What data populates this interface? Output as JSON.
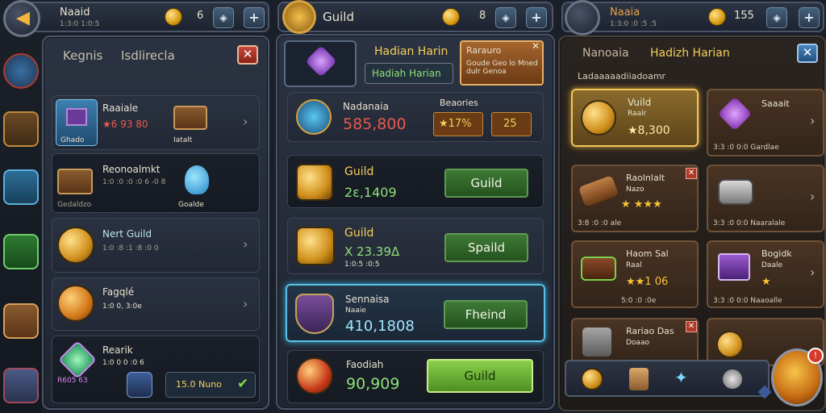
{
  "left": {
    "topbar": {
      "title": "Naaid",
      "subtitle": "1:3:0 1:0:5",
      "coins": "6"
    },
    "panel": {
      "tab_a": "Kegnis",
      "tab_b": "Isdlirecla",
      "rows": [
        {
          "title": "Raaiale",
          "value": "★6 93 80",
          "caption": "Ghado",
          "item_caption": "Iatalt"
        },
        {
          "title": "Reonoalmkt",
          "subtitle": "1:0 :0 :0 :0 6 -0 8",
          "caption": "Gedaldzo",
          "item_caption": "Goalde"
        },
        {
          "title": "Nert Guild",
          "value": "1:0 :8 :1 :8 :0 0"
        },
        {
          "title": "Fagqlé",
          "value": "1:0 0, 3:0e"
        },
        {
          "title": "Rearik",
          "value": "1:0 0 0 :0 6",
          "price": "R605 63"
        }
      ],
      "footer_value": "15.0 Nuno"
    }
  },
  "middle": {
    "topbar": {
      "title": "Guild",
      "coins": "8"
    },
    "header": {
      "title": "Hadian Harin",
      "tab": "Hadiah Harian",
      "banner_title": "Rarauro",
      "banner_text": "Goude Geo lo Mned dulr Genoa"
    },
    "rows": [
      {
        "title": "Nadanaia",
        "value": "585,800",
        "label": "Beaories",
        "badge": "★17%",
        "count": "25"
      },
      {
        "title": "Guild",
        "value": "2ε,1409",
        "button": "Guild"
      },
      {
        "title": "Guild",
        "value": "X 23.39Δ",
        "caption": "1:0:5 :0:5",
        "button": "Spaild"
      },
      {
        "title": "Sennaisa",
        "subtitle": "Naaie",
        "value": "410,1808",
        "button": "Fheind"
      },
      {
        "title": "Faodiah",
        "value": "90,909",
        "button": "Guild"
      }
    ]
  },
  "right": {
    "topbar": {
      "title": "Naaia",
      "subtitle": "1:3:0 :0 :5 :5",
      "coins": "155"
    },
    "header": {
      "tab_a": "Nanoaia",
      "tab_b": "Hadizh Harian",
      "list_title": "Ladaaaaadiiadoamr"
    },
    "tiles": [
      {
        "title": "Vuild",
        "subtitle": "Raalr",
        "value": "★8,300"
      },
      {
        "title": "Saaait",
        "caption": "3:3 :0 0:0  Gardlae"
      },
      {
        "title": "Raolnlalt",
        "subtitle": "Nazo",
        "stars": "★ ★★★",
        "caption": "3:8 :0 :0 ale"
      },
      {
        "title": "",
        "caption": "3:3 :0 0:0  Naaralale"
      },
      {
        "title": "Haom Sal",
        "subtitle": "Raal",
        "stars": "★★1 06",
        "caption": "5:0 :0 :0e"
      },
      {
        "title": "Bogidk",
        "subtitle": "Daale",
        "stars": "★",
        "caption": "3:3 :0 0:0  Naaoalle"
      },
      {
        "title": "Rariao Das",
        "subtitle": "Doaao"
      },
      {
        "title": ""
      }
    ]
  },
  "colors": {
    "gold": "#f5cf5b",
    "red": "#e85a4d",
    "green": "#8fe07a",
    "highlight": "#59c1e6"
  }
}
